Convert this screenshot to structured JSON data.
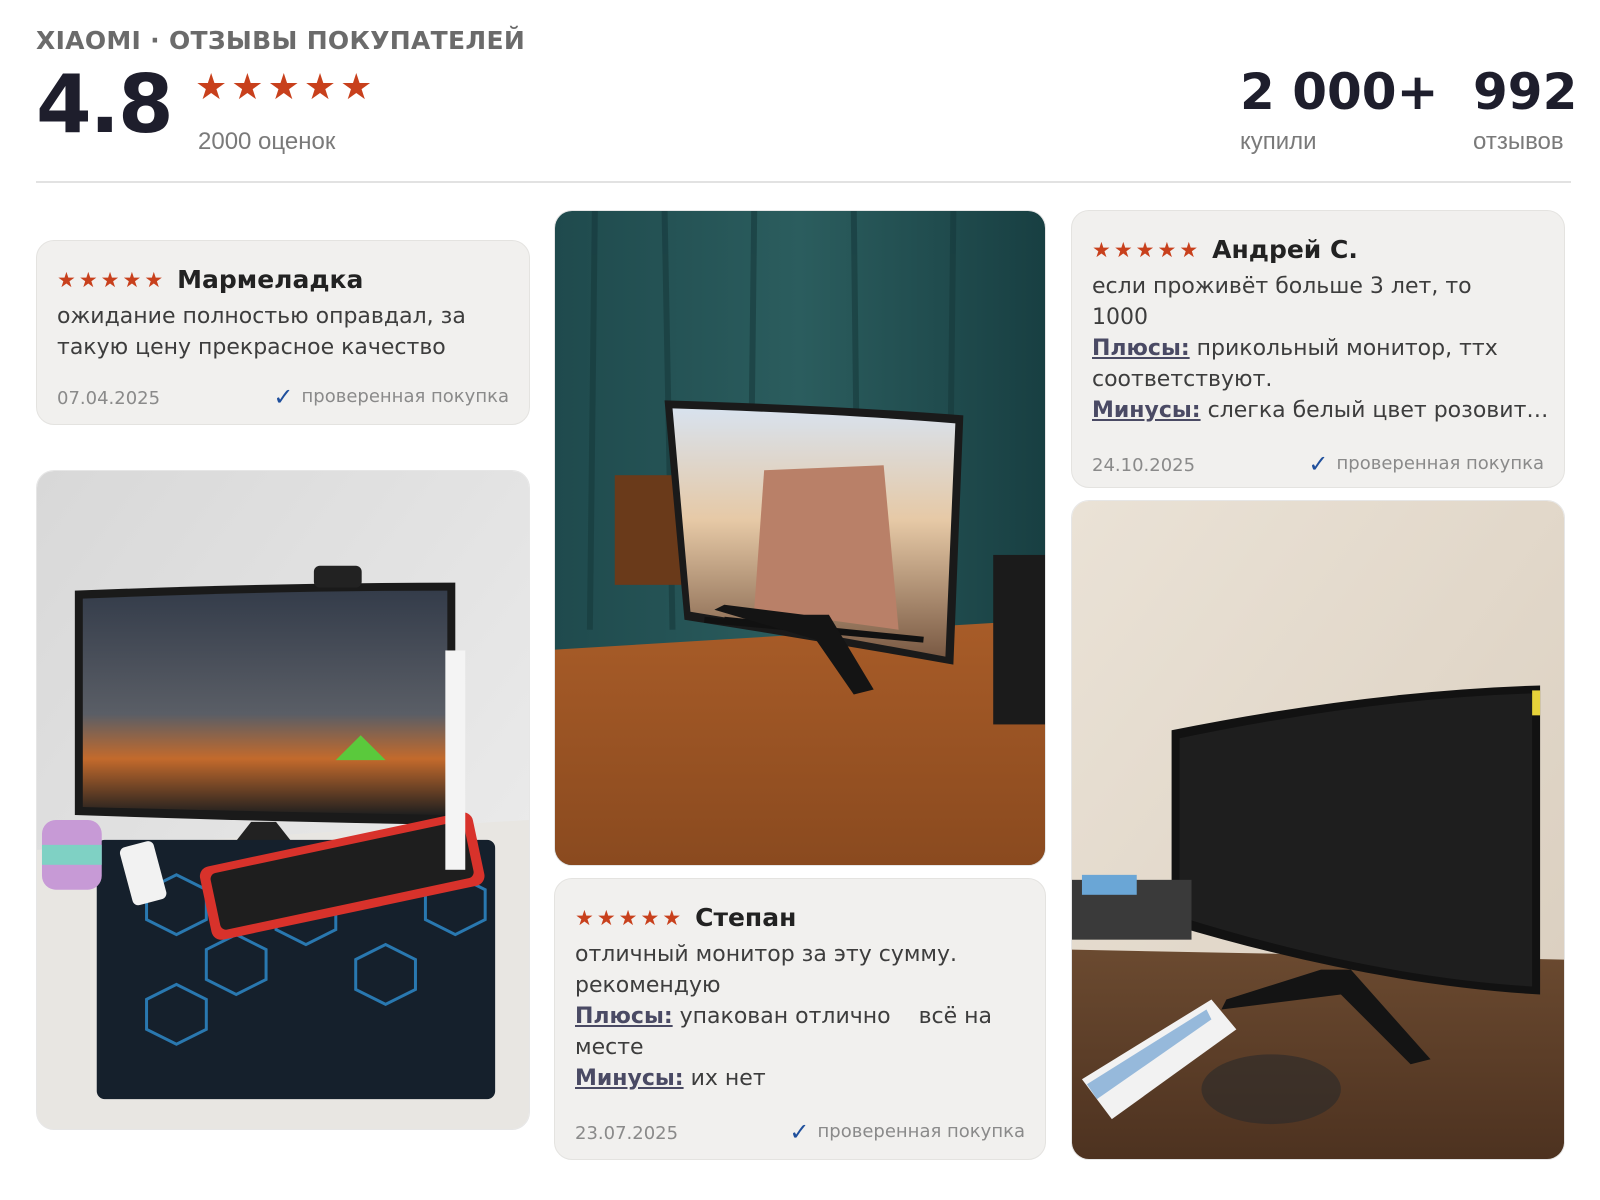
{
  "header": {
    "subtitle": "XIAOMI · ОТЗЫВЫ ПОКУПАТЕЛЕЙ",
    "rating": "4.8",
    "rating_stars": 5,
    "ratings_count": "2000 оценок",
    "bought_value": "2 000+",
    "bought_label": "купили",
    "reviews_value": "992",
    "reviews_label": "отзывов"
  },
  "reviews": [
    {
      "author": "Мармеладка",
      "stars": 5,
      "text": "ожидание полностью оправдал, за такую цену прекрасное качество",
      "date": "07.04.2025",
      "verified": "проверенная покупка"
    },
    {
      "author": "Андрей С.",
      "stars": 5,
      "text": "если проживёт больше 3 лет, то 1000",
      "pros_label": "Плюсы:",
      "pros": "прикольный монитор, ттх соответствуют.",
      "cons_label": "Минусы:",
      "cons": "слегка белый цвет розовит…",
      "date": "24.10.2025",
      "verified": "проверенная покупка"
    },
    {
      "author": "Степан",
      "stars": 5,
      "text": "отличный монитор за эту сумму. рекомендую",
      "pros_label": "Плюсы:",
      "pros": "упакован отлично    всё на месте",
      "cons_label": "Минусы:",
      "cons": "их нет",
      "date": "23.07.2025",
      "verified": "проверенная покупка"
    }
  ],
  "colors": {
    "star": "#c8401c",
    "check": "#1f4f9c",
    "card_bg": "#f1f0ee"
  }
}
